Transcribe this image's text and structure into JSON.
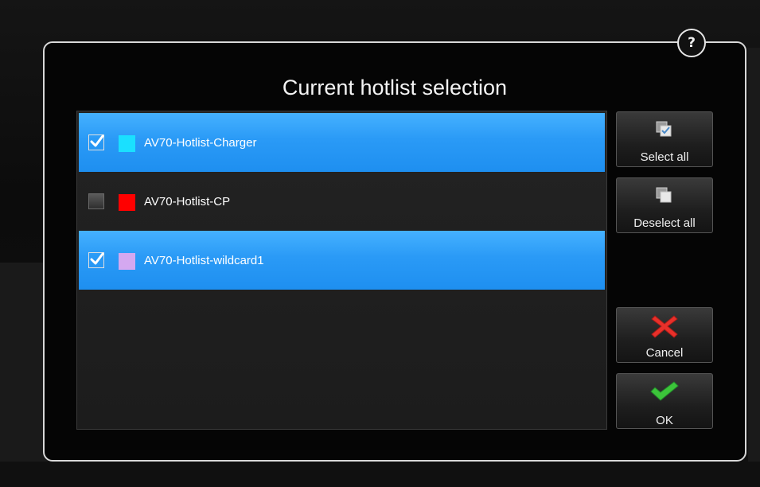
{
  "dialog": {
    "title": "Current hotlist selection",
    "help_label": "?"
  },
  "hotlists": [
    {
      "label": "AV70-Hotlist-Charger",
      "checked": true,
      "color": "#1ae0ff"
    },
    {
      "label": "AV70-Hotlist-CP",
      "checked": false,
      "color": "#ff0000"
    },
    {
      "label": "AV70-Hotlist-wildcard1",
      "checked": true,
      "color": "#d4a8f0"
    }
  ],
  "buttons": {
    "select_all": "Select all",
    "deselect_all": "Deselect all",
    "cancel": "Cancel",
    "ok": "OK"
  },
  "icons": {
    "select_all": "select-all-icon",
    "deselect_all": "deselect-all-icon",
    "cancel": "red-x-icon",
    "ok": "green-check-icon",
    "checkbox_checked": "checkmark-icon"
  },
  "colors": {
    "selected_row": "#2a9af6",
    "cancel_icon": "#e8302a",
    "ok_icon": "#3cc43a"
  }
}
